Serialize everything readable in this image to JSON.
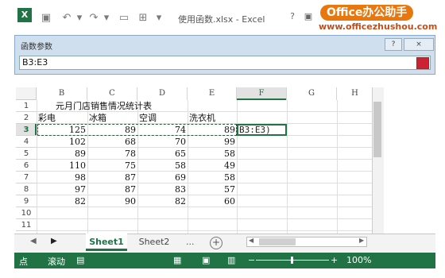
{
  "titlebar": {
    "title": "使用函数.xlsx - Excel",
    "help": "?",
    "excel_letter": "X"
  },
  "brand": {
    "name": "Office办公助手",
    "url": "www.officezhushou.com"
  },
  "dialog": {
    "title": "函数参数",
    "help": "?",
    "close": "×",
    "input_value": "B3:E3"
  },
  "sheet": {
    "columns": [
      "B",
      "C",
      "D",
      "E",
      "F",
      "G",
      "H"
    ],
    "rows": [
      "1",
      "2",
      "3",
      "4",
      "5",
      "6",
      "7",
      "8",
      "9",
      "10",
      "11"
    ],
    "title": "元月门店销售情况统计表",
    "headers": [
      "彩电",
      "冰箱",
      "空调",
      "洗衣机"
    ],
    "data": [
      [
        125,
        89,
        74,
        89
      ],
      [
        102,
        68,
        70,
        99
      ],
      [
        89,
        78,
        65,
        58
      ],
      [
        110,
        75,
        58,
        49
      ],
      [
        98,
        87,
        69,
        58
      ],
      [
        97,
        87,
        83,
        57
      ],
      [
        82,
        90,
        82,
        60
      ]
    ],
    "active_cell_text": "B3:E3)"
  },
  "tabs": {
    "sheets": [
      "Sheet1",
      "Sheet2"
    ],
    "active": "Sheet1",
    "more": "...",
    "add": "+"
  },
  "status": {
    "mode": "点",
    "scroll": "滚动",
    "zoom": "100%"
  },
  "colors": {
    "accent": "#217346",
    "brand": "#e8770e"
  }
}
